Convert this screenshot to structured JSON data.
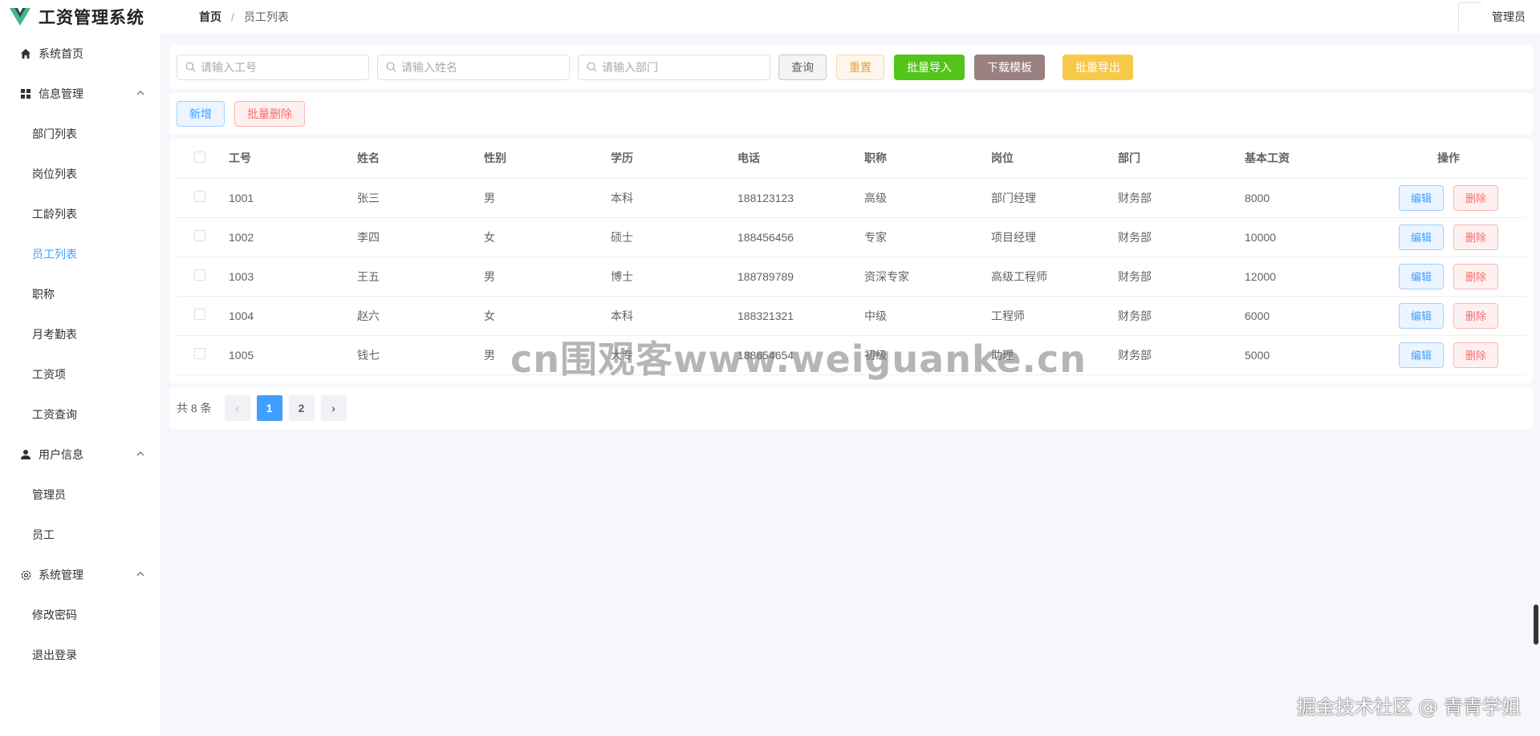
{
  "app": {
    "title": "工资管理系统"
  },
  "breadcrumb": {
    "home": "首页",
    "separator": "/",
    "current": "员工列表"
  },
  "user": {
    "name": "管理员"
  },
  "sidebar": {
    "items": [
      {
        "label": "系统首页",
        "icon": "home-icon"
      },
      {
        "label": "信息管理",
        "icon": "grid-icon",
        "children": [
          "部门列表",
          "岗位列表",
          "工龄列表",
          "员工列表",
          "职称",
          "月考勤表",
          "工资项",
          "工资查询"
        ]
      },
      {
        "label": "用户信息",
        "icon": "user-icon",
        "children": [
          "管理员",
          "员工"
        ]
      },
      {
        "label": "系统管理",
        "icon": "gear-icon",
        "children": [
          "修改密码",
          "退出登录"
        ]
      }
    ],
    "active": "员工列表",
    "active_color": "#409eff"
  },
  "search": {
    "empno_placeholder": "请输入工号",
    "name_placeholder": "请输入姓名",
    "dept_placeholder": "请输入部门",
    "query_label": "查询",
    "reset_label": "重置",
    "import_label": "批量导入",
    "template_label": "下载模板",
    "export_label": "批量导出"
  },
  "actions": {
    "add_label": "新增",
    "batch_delete_label": "批量删除"
  },
  "table": {
    "columns": [
      "工号",
      "姓名",
      "性别",
      "学历",
      "电话",
      "职称",
      "岗位",
      "部门",
      "基本工资",
      "操作"
    ],
    "rows": [
      [
        "1001",
        "张三",
        "男",
        "本科",
        "188123123",
        "高级",
        "部门经理",
        "财务部",
        "8000"
      ],
      [
        "1002",
        "李四",
        "女",
        "硕士",
        "188456456",
        "专家",
        "项目经理",
        "财务部",
        "10000"
      ],
      [
        "1003",
        "王五",
        "男",
        "博士",
        "188789789",
        "资深专家",
        "高级工程师",
        "财务部",
        "12000"
      ],
      [
        "1004",
        "赵六",
        "女",
        "本科",
        "188321321",
        "中级",
        "工程师",
        "财务部",
        "6000"
      ],
      [
        "1005",
        "钱七",
        "男",
        "大专",
        "188654654",
        "初级",
        "助理",
        "财务部",
        "5000"
      ]
    ],
    "edit_label": "编辑",
    "delete_label": "删除"
  },
  "pager": {
    "total": "共 8 条",
    "pages": [
      "1",
      "2"
    ],
    "current": "1",
    "prev": "‹",
    "next": "›"
  },
  "watermarks": {
    "center": "cn围观客www.weiguanke.cn",
    "corner": "掘金技术社区 @ 青青学姐"
  }
}
